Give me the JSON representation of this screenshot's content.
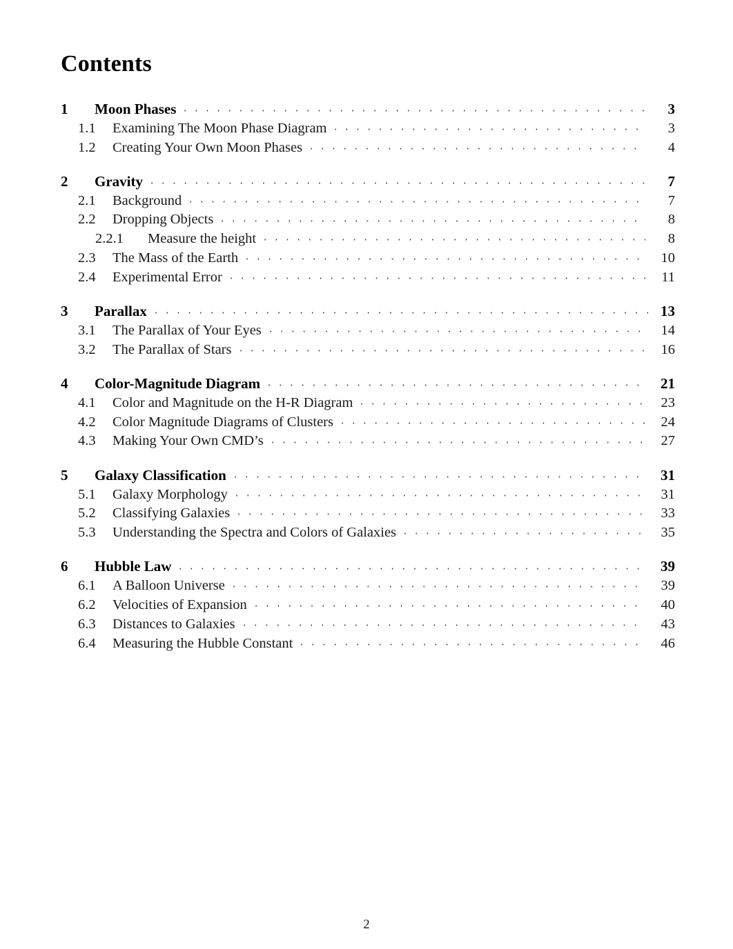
{
  "document": {
    "heading": "Contents",
    "folio": "2"
  },
  "toc": {
    "groups": [
      {
        "section": {
          "number": "1",
          "label": "Moon Phases",
          "page": "3"
        },
        "entries": [
          {
            "level": 2,
            "number": "1.1",
            "label": "Examining The Moon Phase Diagram",
            "page": "3"
          },
          {
            "level": 2,
            "number": "1.2",
            "label": "Creating Your Own Moon Phases",
            "page": "4"
          }
        ]
      },
      {
        "section": {
          "number": "2",
          "label": "Gravity",
          "page": "7"
        },
        "entries": [
          {
            "level": 2,
            "number": "2.1",
            "label": "Background",
            "page": "7"
          },
          {
            "level": 2,
            "number": "2.2",
            "label": "Dropping Objects",
            "page": "8"
          },
          {
            "level": 3,
            "number": "2.2.1",
            "label": "Measure the height",
            "page": "8"
          },
          {
            "level": 2,
            "number": "2.3",
            "label": "The Mass of the Earth",
            "page": "10"
          },
          {
            "level": 2,
            "number": "2.4",
            "label": "Experimental Error",
            "page": "11"
          }
        ]
      },
      {
        "section": {
          "number": "3",
          "label": "Parallax",
          "page": "13"
        },
        "entries": [
          {
            "level": 2,
            "number": "3.1",
            "label": "The Parallax of Your Eyes",
            "page": "14"
          },
          {
            "level": 2,
            "number": "3.2",
            "label": "The Parallax of Stars",
            "page": "16"
          }
        ]
      },
      {
        "section": {
          "number": "4",
          "label": "Color-Magnitude Diagram",
          "page": "21"
        },
        "entries": [
          {
            "level": 2,
            "number": "4.1",
            "label": "Color and Magnitude on the H-R Diagram",
            "page": "23"
          },
          {
            "level": 2,
            "number": "4.2",
            "label": "Color Magnitude Diagrams of Clusters",
            "page": "24"
          },
          {
            "level": 2,
            "number": "4.3",
            "label": "Making Your Own CMD’s",
            "page": "27"
          }
        ]
      },
      {
        "section": {
          "number": "5",
          "label": "Galaxy Classification",
          "page": "31"
        },
        "entries": [
          {
            "level": 2,
            "number": "5.1",
            "label": "Galaxy Morphology",
            "page": "31"
          },
          {
            "level": 2,
            "number": "5.2",
            "label": "Classifying Galaxies",
            "page": "33"
          },
          {
            "level": 2,
            "number": "5.3",
            "label": "Understanding the Spectra and Colors of Galaxies",
            "page": "35"
          }
        ]
      },
      {
        "section": {
          "number": "6",
          "label": "Hubble Law",
          "page": "39"
        },
        "entries": [
          {
            "level": 2,
            "number": "6.1",
            "label": "A Balloon Universe",
            "page": "39"
          },
          {
            "level": 2,
            "number": "6.2",
            "label": "Velocities of Expansion",
            "page": "40"
          },
          {
            "level": 2,
            "number": "6.3",
            "label": "Distances to Galaxies",
            "page": "43"
          },
          {
            "level": 2,
            "number": "6.4",
            "label": "Measuring the Hubble Constant",
            "page": "46"
          }
        ]
      }
    ]
  },
  "colors": {
    "page_background": "#ffffff",
    "text": "#1a1a1a",
    "heading": "#000000",
    "leader_dots": "#2b2b2b"
  }
}
